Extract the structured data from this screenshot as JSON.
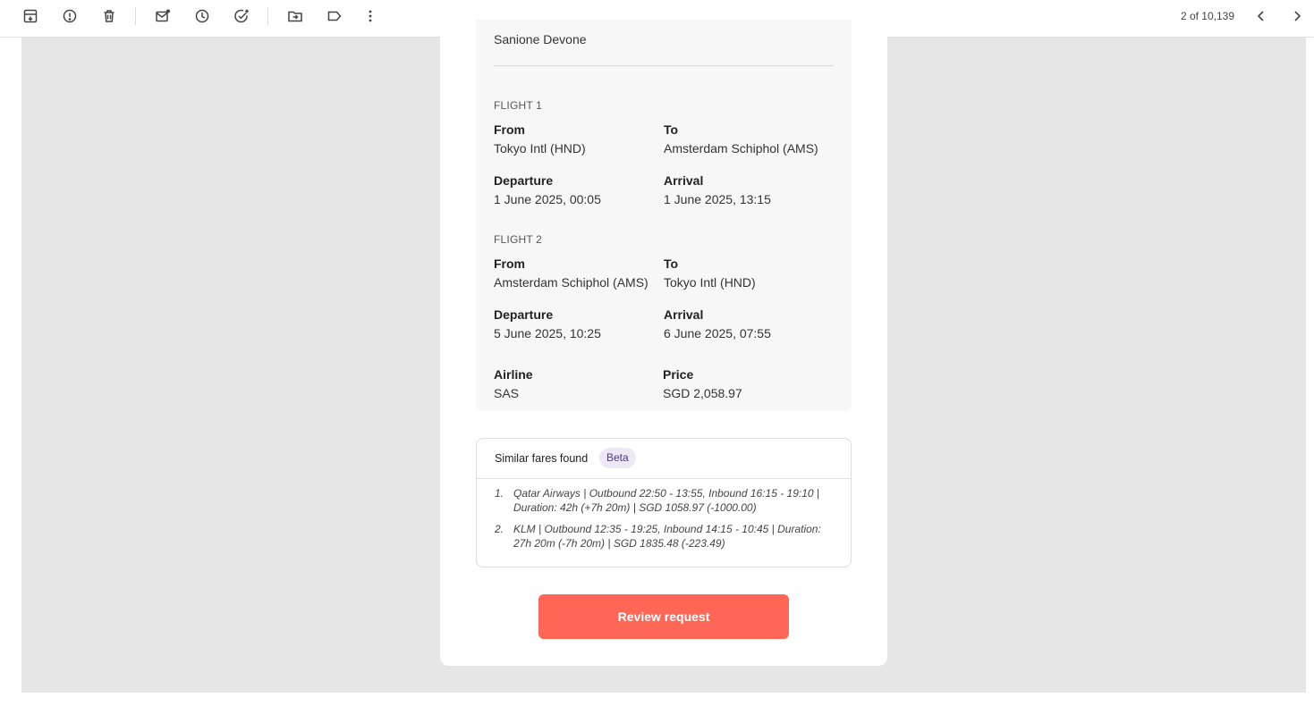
{
  "toolbar": {
    "icons": [
      "archive-icon",
      "report-spam-icon",
      "delete-icon",
      "mark-unread-icon",
      "snooze-icon",
      "add-task-icon",
      "move-to-icon",
      "label-icon",
      "more-icon"
    ],
    "pager": "2 of 10,139"
  },
  "email": {
    "passenger": "Sanione Devone",
    "flight1": {
      "title": "FLIGHT 1",
      "from_label": "From",
      "from": "Tokyo Intl (HND)",
      "to_label": "To",
      "to": "Amsterdam Schiphol (AMS)",
      "departure_label": "Departure",
      "departure": "1 June 2025, 00:05",
      "arrival_label": "Arrival",
      "arrival": "1 June 2025, 13:15"
    },
    "flight2": {
      "title": "FLIGHT 2",
      "from_label": "From",
      "from": "Amsterdam Schiphol (AMS)",
      "to_label": "To",
      "to": "Tokyo Intl (HND)",
      "departure_label": "Departure",
      "departure": "5 June 2025, 10:25",
      "arrival_label": "Arrival",
      "arrival": "6 June 2025, 07:55"
    },
    "airline_label": "Airline",
    "airline": "SAS",
    "price_label": "Price",
    "price": "SGD 2,058.97",
    "similar": {
      "title": "Similar fares found",
      "badge": "Beta",
      "items": [
        {
          "num": "1.",
          "text": "Qatar Airways | Outbound 22:50 - 13:55, Inbound 16:15 - 19:10 | Duration: 42h (+7h 20m) | SGD 1058.97 (-1000.00)"
        },
        {
          "num": "2.",
          "text": "KLM | Outbound 12:35 - 19:25, Inbound 14:15 - 10:45 | Duration: 27h 20m (-7h 20m) | SGD 1835.48 (-223.49)"
        }
      ]
    },
    "review_button": "Review request"
  },
  "colors": {
    "accent": "#fe6655",
    "badge_bg": "#ece8f6",
    "badge_text": "#4a3a8a"
  }
}
